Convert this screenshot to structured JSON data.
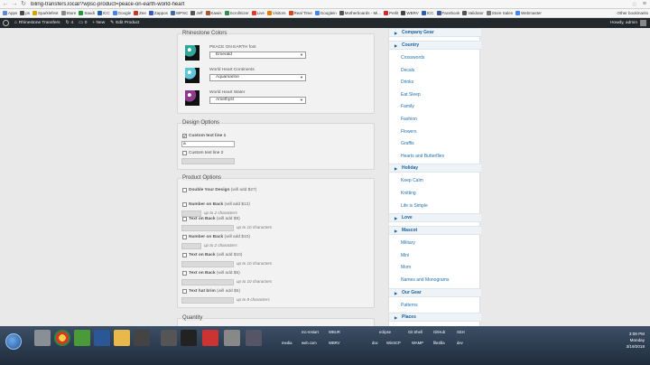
{
  "browser": {
    "url": "biling-transfers.local/?wpsc-product=peace-on-earth-world-heart"
  },
  "bookmarks": [
    {
      "label": "Apps",
      "color": "#5b8bd6"
    },
    {
      "label": "ps",
      "color": "#4a4a4a"
    },
    {
      "label": "Sparklefest",
      "color": "#d9a300"
    },
    {
      "label": "Store",
      "color": "#8a8a8a"
    },
    {
      "label": "Saudi",
      "color": "#1b9a3a"
    },
    {
      "label": "ICC",
      "color": "#2a60b0"
    },
    {
      "label": "Google",
      "color": "#4285f4"
    },
    {
      "label": "Zee",
      "color": "#c23a2a"
    },
    {
      "label": "Zappos",
      "color": "#3b5bbf"
    },
    {
      "label": "WPSC",
      "color": "#3a6ea5"
    },
    {
      "label": "Jeff",
      "color": "#555555"
    },
    {
      "label": "Kawis",
      "color": "#aa5533"
    },
    {
      "label": "Scrollnizer",
      "color": "#2f8f4f"
    },
    {
      "label": "Live",
      "color": "#e03a2a"
    },
    {
      "label": "Visitors",
      "color": "#e07b00"
    },
    {
      "label": "Real Time",
      "color": "#d24a1f"
    },
    {
      "label": "Googlein",
      "color": "#4285f4"
    },
    {
      "label": "Motherboards - Mi...",
      "color": "#555555"
    },
    {
      "label": "Perlit",
      "color": "#d22a2a"
    },
    {
      "label": "WBRV",
      "color": "#444444"
    },
    {
      "label": "ICC",
      "color": "#2a60b0"
    },
    {
      "label": "Facebook",
      "color": "#3b5998"
    },
    {
      "label": "Validator",
      "color": "#555555"
    },
    {
      "label": "Store Sales",
      "color": "#7a7a7a"
    },
    {
      "label": "Webmaster",
      "color": "#4285f4"
    }
  ],
  "bookmarks_other": "Other bookmarks",
  "wpbar": {
    "site": "Rhinestone Transfers",
    "updates": "4",
    "comments": "0",
    "new": "+ New",
    "edit": "Edit Product",
    "howdy": "Howdy, admin"
  },
  "rhinestone": {
    "legend": "Rhinestone Colors",
    "rows": [
      {
        "label": "PEACE ON EARTH font",
        "selected": "Emerald"
      },
      {
        "label": "World Heart Continents",
        "selected": "Aquamarine"
      },
      {
        "label": "World Heart Water",
        "selected": "Amethyst"
      }
    ],
    "swatch_colors": [
      "#2fa89a",
      "#5fc6d8",
      "#8e3a8e"
    ]
  },
  "design": {
    "legend": "Design Options",
    "line1_label": "Custom text line 1",
    "line1_checked": "✔",
    "line1_value": "a",
    "line2_label": "Custom text line 2"
  },
  "product": {
    "legend": "Product Options",
    "items": [
      {
        "label": "Double Your Design",
        "addon": "(will add $27)",
        "note": ""
      },
      {
        "label": "Number on Back",
        "addon": "(will add $12)",
        "note": "up to 2 characters"
      },
      {
        "label": "Text on Back",
        "addon": "(will add $9)",
        "note": "up to 10 characters"
      },
      {
        "label": "Number on Back",
        "addon": "(will add $10)",
        "note": "up to 2 characters"
      },
      {
        "label": "Text on Back",
        "addon": "(will add $10)",
        "note": "up to 10 characters"
      },
      {
        "label": "Text on Back",
        "addon": "(will add $5)",
        "note": "up to 10 characters"
      },
      {
        "label": "Text hat brim",
        "addon": "(will add $5)",
        "note": "up to 8 characters"
      }
    ]
  },
  "quantity_legend": "Quantity",
  "sidebar": [
    {
      "type": "cat",
      "label": "Company Gear"
    },
    {
      "type": "cat",
      "label": "Country"
    },
    {
      "type": "link",
      "label": "Crosswords"
    },
    {
      "type": "link",
      "label": "Decals"
    },
    {
      "type": "link",
      "label": "Drinks"
    },
    {
      "type": "link",
      "label": "Eat Sleep"
    },
    {
      "type": "link",
      "label": "Family"
    },
    {
      "type": "link",
      "label": "Fashion"
    },
    {
      "type": "link",
      "label": "Flowers"
    },
    {
      "type": "link",
      "label": "Graffis"
    },
    {
      "type": "link",
      "label": "Hearts and Butterflies"
    },
    {
      "type": "cat",
      "label": "Holiday"
    },
    {
      "type": "link",
      "label": "Keep Calm"
    },
    {
      "type": "link",
      "label": "Knitting"
    },
    {
      "type": "link",
      "label": "Life is Simple"
    },
    {
      "type": "cat",
      "label": "Love"
    },
    {
      "type": "cat",
      "label": "Mascot"
    },
    {
      "type": "link",
      "label": "Military"
    },
    {
      "type": "link",
      "label": "Mini"
    },
    {
      "type": "link",
      "label": "Mom"
    },
    {
      "type": "link",
      "label": "Names and Monograms"
    },
    {
      "type": "cat",
      "label": "Our Gear"
    },
    {
      "type": "link",
      "label": "Patterns"
    },
    {
      "type": "cat",
      "label": "Places"
    }
  ],
  "taskbar": {
    "items_top": [
      "mc-restart",
      "WBUR",
      "eclipse",
      "Git Shell",
      "GitHub",
      "SSH"
    ],
    "items_bottom": [
      "media",
      "web.com",
      "WBRV",
      "doc",
      "WinSCP",
      "WAMP",
      "filezilla",
      "dev"
    ],
    "time": "3:08 PM",
    "day": "Monday",
    "date": "3/19/2018"
  }
}
